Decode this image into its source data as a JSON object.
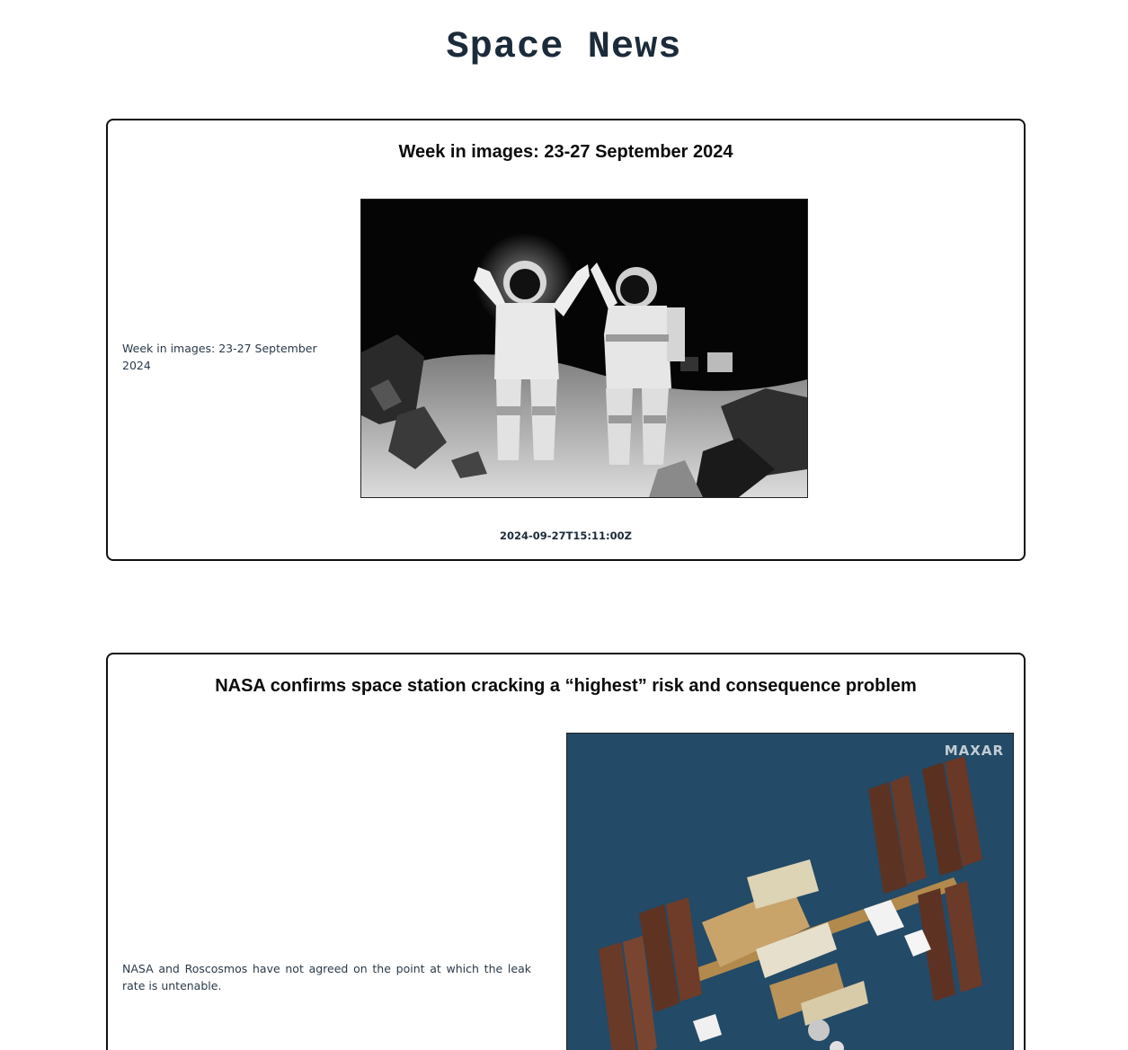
{
  "page": {
    "title": "Space News"
  },
  "articles": [
    {
      "title": "Week in images: 23-27 September 2024",
      "description": "Week in images: 23-27 September 2024",
      "published_at": "2024-09-27T15:11:00Z",
      "image_subject": "two-astronauts-in-spacesuits-on-simulated-lunar-surface"
    },
    {
      "title": "NASA confirms space station cracking a “highest” risk and consequence problem",
      "description": "NASA and Roscosmos have not agreed on the point at which the leak rate is untenable.",
      "image_subject": "international-space-station-satellite-image",
      "image_watermark": "MAXAR"
    }
  ],
  "colors": {
    "title": "#1c2b3a",
    "card_border": "#111111",
    "text": "#2a3a4a",
    "iss_background": "#234a66"
  }
}
